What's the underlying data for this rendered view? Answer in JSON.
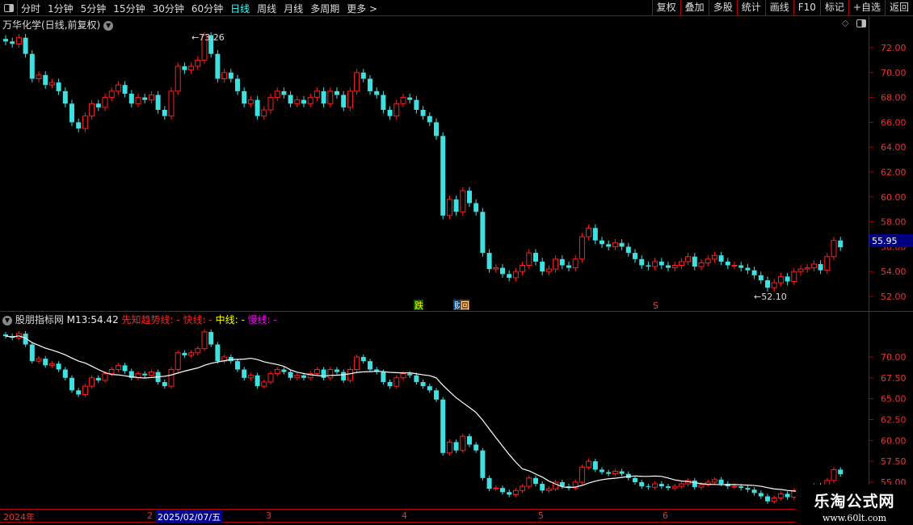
{
  "toolbar": {
    "periods": [
      "分时",
      "1分钟",
      "5分钟",
      "15分钟",
      "30分钟",
      "60分钟",
      "日线",
      "周线",
      "月线",
      "多周期",
      "更多 >"
    ],
    "active": "日线",
    "buttons": [
      "复权",
      "叠加",
      "多股",
      "统计",
      "画线",
      "F10",
      "标记",
      "+自选",
      "返回"
    ]
  },
  "main": {
    "title": "万华化学(日线,前复权)",
    "high_label": "73.26",
    "low_label": "52.10",
    "current_price": "55.95",
    "y_ticks": [
      "72.00",
      "70.00",
      "68.00",
      "66.00",
      "64.00",
      "62.00",
      "60.00",
      "58.00",
      "56.00",
      "54.00",
      "52.00"
    ],
    "markers": [
      "跌",
      "财",
      "回",
      "S"
    ]
  },
  "indicator": {
    "name": "股朋指标网",
    "m13_label": "M13:",
    "m13_value": "54.42",
    "lines": [
      "先知趋势线: -",
      "快线: -",
      "中线: -",
      "慢线: -"
    ],
    "y_ticks": [
      "70.00",
      "67.50",
      "65.00",
      "62.50",
      "60.00",
      "57.50",
      "55.00"
    ]
  },
  "datebar": {
    "labels": [
      "2024年",
      "2",
      "2025/02/07/五",
      "3",
      "4",
      "5",
      "6"
    ]
  },
  "watermark": {
    "name": "乐淘公式网",
    "url": "www.60lt.com"
  },
  "colors": {
    "up": "#ff2020",
    "down": "#40e0e0",
    "ma": "#ffffff",
    "axis": "#b00000"
  },
  "chart_data": {
    "type": "candlestick",
    "ylim_main": [
      51.5,
      73.5
    ],
    "ylim_indicator": [
      54,
      72.5
    ],
    "closes": [
      72.5,
      72.3,
      72.8,
      71.5,
      69.5,
      69.8,
      69,
      69.2,
      68.5,
      67.5,
      66,
      65.5,
      66.5,
      67.5,
      67.2,
      68,
      68.5,
      69,
      68.3,
      67.5,
      68,
      67.8,
      68.2,
      67,
      66.5,
      68.5,
      70.5,
      70.2,
      70.5,
      71,
      73,
      71.5,
      69.5,
      70,
      69.5,
      68.5,
      67.5,
      67.8,
      66.5,
      67,
      68,
      68.5,
      68.2,
      67.5,
      67.8,
      67.5,
      68,
      68.5,
      67.5,
      68.5,
      68.2,
      67.2,
      68.5,
      70,
      69.5,
      68.5,
      68.2,
      67,
      66.5,
      67.5,
      68,
      67.8,
      67,
      66.5,
      66,
      64.9,
      58.5,
      59.8,
      58.8,
      60.5,
      59.5,
      58.8,
      55.5,
      54.2,
      54.3,
      53.8,
      53.5,
      54,
      54.5,
      55.5,
      54.8,
      54,
      54.2,
      55,
      54.5,
      54.3,
      55,
      56.8,
      57.5,
      56.5,
      56.2,
      56,
      56.3,
      56,
      55.5,
      55,
      54.5,
      54.4,
      54.8,
      54.5,
      54.3,
      54.5,
      54.8,
      55.2,
      54.4,
      54.7,
      55,
      55.3,
      54.8,
      54.5,
      54.5,
      54.3,
      54.1,
      53.7,
      53.3,
      52.7,
      53.1,
      53.6,
      53.2,
      54,
      54.2,
      54.3,
      54.6,
      54.1,
      55.2,
      56.5,
      55.95
    ]
  }
}
